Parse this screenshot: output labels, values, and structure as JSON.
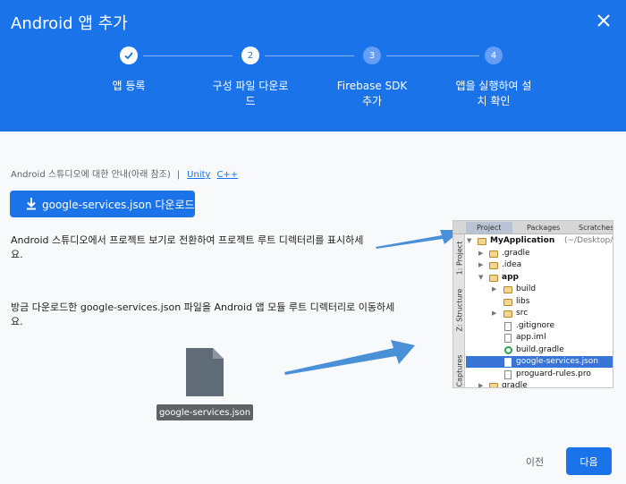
{
  "dialog": {
    "title": "Android 앱 추가",
    "close_icon": "close-icon"
  },
  "steps": [
    {
      "number": "",
      "label": "앱 등록",
      "state": "done"
    },
    {
      "number": "2",
      "label": "구성 파일 다운로드",
      "state": "active"
    },
    {
      "number": "3",
      "label": "Firebase SDK 추가",
      "state": "pending"
    },
    {
      "number": "4",
      "label": "앱을 실행하여 설치 확인",
      "state": "pending"
    }
  ],
  "guide": {
    "text": "Android 스튜디오에 대한 안내(아래 참조)",
    "separator": "|",
    "links": [
      "Unity",
      "C++"
    ]
  },
  "download_button": {
    "label": "google-services.json 다운로드",
    "icon": "download-icon"
  },
  "instructions": [
    "Android 스튜디오에서 프로젝트 보기로 전환하여 프로젝트 루트 디렉터리를 표시하세요.",
    "방금 다운로드한 google-services.json 파일을 Android 앱 모듈 루트 디렉터리로 이동하세요."
  ],
  "file_chip": {
    "label": "google-services.json"
  },
  "ide": {
    "tabs": [
      "Project",
      "Packages",
      "Scratches"
    ],
    "side_tabs": [
      "1: Project",
      "Z: Structure",
      "Captures"
    ],
    "tree": [
      {
        "label": "MyApplication",
        "suffix": "(~/Desktop/My",
        "type": "module"
      },
      {
        "label": ".gradle",
        "type": "folder"
      },
      {
        "label": ".idea",
        "type": "folder"
      },
      {
        "label": "app",
        "type": "folder"
      },
      {
        "label": "build",
        "type": "folder"
      },
      {
        "label": "libs",
        "type": "folder"
      },
      {
        "label": "src",
        "type": "folder"
      },
      {
        "label": ".gitignore",
        "type": "file"
      },
      {
        "label": "app.iml",
        "type": "file"
      },
      {
        "label": "build.gradle",
        "type": "gradle"
      },
      {
        "label": "google-services.json",
        "type": "json",
        "selected": true
      },
      {
        "label": "proguard-rules.pro",
        "type": "file"
      },
      {
        "label": "gradle",
        "type": "folder"
      }
    ]
  },
  "footer": {
    "prev_label": "이전",
    "next_label": "다음"
  },
  "colors": {
    "brand_blue": "#1a73e8",
    "step_pending": "#669df6",
    "arrow": "#4a90d9",
    "ide_selected": "#3875d7"
  }
}
